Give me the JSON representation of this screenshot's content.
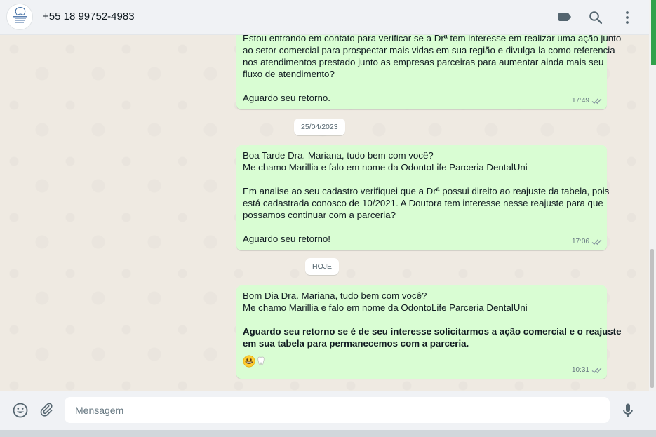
{
  "header": {
    "contact_phone": "+55 18 99752-4983",
    "icons": [
      "label-icon",
      "search-icon",
      "menu-icon"
    ]
  },
  "messages": [
    {
      "lines": [
        "Estou entrando em contato para verificar se a Drª tem interesse em realizar uma ação junto",
        "ao setor comercial para prospectar mais vidas em sua região e divulga-la como referencia",
        "nos atendimentos prestado junto as empresas parceiras para aumentar ainda mais seu",
        "fluxo de atendimento?",
        "",
        "Aguardo seu retorno."
      ],
      "time": "17:49"
    },
    {
      "lines": [
        "Boa Tarde Dra. Mariana, tudo bem com você?",
        "Me chamo Marillia e falo em nome da OdontoLife Parceria DentalUni",
        "",
        "Em analise ao seu cadastro verifiquei que a Drª possui direito ao reajuste da tabela, pois",
        "está cadastrada conosco de 10/2021. A Doutora tem interesse nesse reajuste para que",
        "possamos continuar com a parceria?",
        "",
        "Aguardo seu retorno!"
      ],
      "time": "17:06"
    },
    {
      "lines": [
        "Bom Dia Dra. Mariana, tudo bem com você?",
        "Me chamo Marillia e falo em nome da OdontoLife Parceria DentalUni",
        ""
      ],
      "bold_lines": [
        "Aguardo seu retorno se é de seu interesse solicitarmos a ação comercial e o reajuste",
        "em sua tabela para permanecemos com a parceria."
      ],
      "emojis": [
        "grinning-face",
        "tooth"
      ],
      "time": "10:31"
    }
  ],
  "dates": {
    "first": "25/04/2023",
    "second": "HOJE"
  },
  "footer": {
    "placeholder": "Mensagem"
  },
  "colors": {
    "bubble": "#d9fdd3",
    "chat_bg": "#efeae2",
    "header_bg": "#f0f2f5",
    "tick": "#8696a0"
  }
}
